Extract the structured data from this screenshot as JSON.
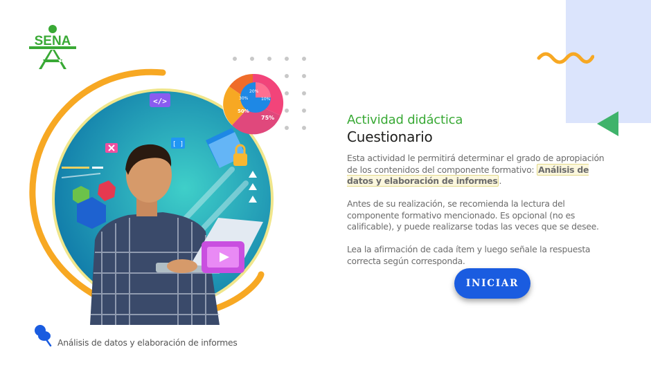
{
  "brand": {
    "logo_text": "SENA"
  },
  "activity": {
    "subtitle": "Actividad didáctica",
    "title": "Cuestionario",
    "p1_before": "Esta actividad le permitirá determinar el grado de apropiación de los contenidos del componente formativo: ",
    "p1_highlight": "Análisis de datos y elaboración de informes",
    "p1_after": ".",
    "p2": "Antes de su realización, se recomienda la lectura del componente formativo mencionado.  Es opcional (no es calificable), y puede realizarse todas las veces que se desee.",
    "p3": "Lea la afirmación de cada ítem y luego señale la respuesta correcta según corresponda.",
    "start_button": "INICIAR"
  },
  "illustration": {
    "pie_labels": [
      "75%",
      "50%",
      "30%",
      "20%",
      "10%"
    ],
    "code_icon": "</>",
    "bracket_icon": "[ ]"
  },
  "footer": {
    "text": "Análisis de datos y elaboración de informes"
  },
  "colors": {
    "green": "#39a935",
    "button_blue": "#1a5ce0",
    "orange": "#f7a823",
    "light_blue_panel": "#dbe4fc"
  }
}
